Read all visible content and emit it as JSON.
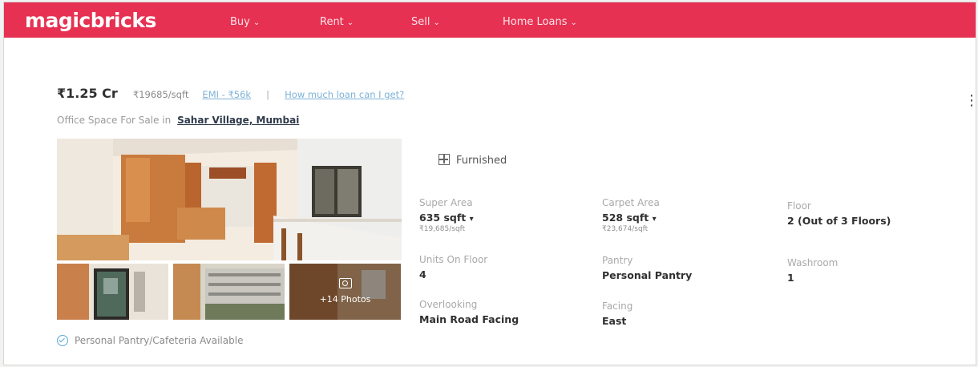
{
  "header": {
    "logo": "magicbricks",
    "nav": [
      {
        "label": "Buy"
      },
      {
        "label": "Rent"
      },
      {
        "label": "Sell"
      },
      {
        "label": "Home Loans"
      }
    ],
    "chevron": "⌄"
  },
  "listing": {
    "price": "₹1.25 Cr",
    "rate": "₹19685/sqft",
    "emi": "EMI - ₹56k",
    "separator": "|",
    "loan_link": "How much loan can I get?",
    "subtitle_prefix": "Office Space For Sale in",
    "location": "Sahar Village, Mumbai",
    "more_icon": "kebab-menu-icon",
    "gallery": {
      "more_photos": "+14 Photos"
    },
    "furnishing": "Furnished",
    "attributes": [
      {
        "label": "Super Area",
        "value": "635 sqft",
        "sub": "₹19,685/sqft"
      },
      {
        "label": "Carpet Area",
        "value": "528 sqft",
        "sub": "₹23,674/sqft"
      },
      {
        "label": "Floor",
        "value": "2 (Out of 3 Floors)"
      },
      {
        "label": "Units On Floor",
        "value": "4"
      },
      {
        "label": "Pantry",
        "value": "Personal Pantry"
      },
      {
        "label": "Washroom",
        "value": "1"
      },
      {
        "label": "Overlooking",
        "value": "Main Road Facing"
      },
      {
        "label": "Facing",
        "value": "East"
      }
    ],
    "amenity": "Personal Pantry/Cafeteria Available"
  },
  "colors": {
    "brand": "#e63152",
    "link": "#7db2d6"
  }
}
